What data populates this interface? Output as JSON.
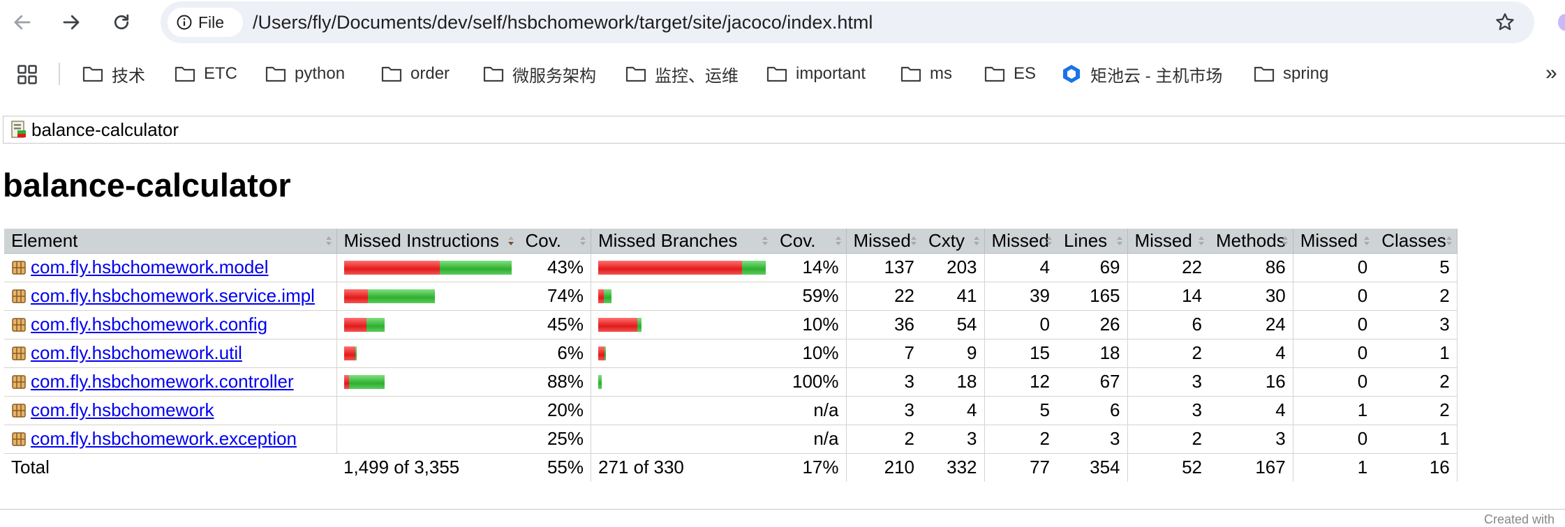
{
  "browser": {
    "chip_label": "File",
    "url": "/Users/fly/Documents/dev/self/hsbchomework/target/site/jacoco/index.html",
    "bookmarks": [
      {
        "label": "技术",
        "icon": "folder-icon"
      },
      {
        "label": "ETC",
        "icon": "folder-icon"
      },
      {
        "label": "python",
        "icon": "folder-icon"
      },
      {
        "label": "order",
        "icon": "folder-icon"
      },
      {
        "label": "微服务架构",
        "icon": "folder-icon"
      },
      {
        "label": "监控、运维",
        "icon": "folder-icon"
      },
      {
        "label": "important",
        "icon": "folder-icon"
      },
      {
        "label": "ms",
        "icon": "folder-icon"
      },
      {
        "label": "ES",
        "icon": "folder-icon"
      },
      {
        "label": "矩池云 - 主机市场",
        "icon": "hexagon-logo-icon"
      },
      {
        "label": "spring",
        "icon": "folder-icon"
      }
    ],
    "more_label": "»"
  },
  "page": {
    "breadcrumb": "balance-calculator",
    "title": "balance-calculator",
    "footer_text": "Created with"
  },
  "colors": {
    "header_bg": "#ced3d6",
    "bar_missed": "#e21a1a",
    "bar_covered": "#2fae2f",
    "link": "#0000ee"
  },
  "table": {
    "headers": [
      "Element",
      "Missed Instructions",
      "Cov.",
      "Missed Branches",
      "Cov.",
      "Missed",
      "Cxty",
      "Missed",
      "Lines",
      "Missed",
      "Methods",
      "Missed",
      "Classes"
    ],
    "rows": [
      {
        "element": "com.fly.hsbchomework.model",
        "instr_cov": "43%",
        "instr_bar": [
          0.57,
          0.43,
          1.0
        ],
        "branch_cov": "14%",
        "branch_bar": [
          0.86,
          0.14,
          1.0
        ],
        "missed_cxty": "137",
        "cxty": "203",
        "missed_lines": "4",
        "lines": "69",
        "missed_methods": "22",
        "methods": "86",
        "missed_classes": "0",
        "classes": "5"
      },
      {
        "element": "com.fly.hsbchomework.service.impl",
        "instr_cov": "74%",
        "instr_bar": [
          0.26,
          0.74,
          0.54
        ],
        "branch_cov": "59%",
        "branch_bar": [
          0.41,
          0.59,
          0.08
        ],
        "missed_cxty": "22",
        "cxty": "41",
        "missed_lines": "39",
        "lines": "165",
        "missed_methods": "14",
        "methods": "30",
        "missed_classes": "0",
        "classes": "2"
      },
      {
        "element": "com.fly.hsbchomework.config",
        "instr_cov": "45%",
        "instr_bar": [
          0.55,
          0.45,
          0.24
        ],
        "branch_cov": "10%",
        "branch_bar": [
          0.9,
          0.1,
          0.26
        ],
        "missed_cxty": "36",
        "cxty": "54",
        "missed_lines": "0",
        "lines": "26",
        "missed_methods": "6",
        "methods": "24",
        "missed_classes": "0",
        "classes": "3"
      },
      {
        "element": "com.fly.hsbchomework.util",
        "instr_cov": "6%",
        "instr_bar": [
          0.94,
          0.06,
          0.07
        ],
        "branch_cov": "10%",
        "branch_bar": [
          0.9,
          0.1,
          0.04
        ],
        "missed_cxty": "7",
        "cxty": "9",
        "missed_lines": "15",
        "lines": "18",
        "missed_methods": "2",
        "methods": "4",
        "missed_classes": "0",
        "classes": "1"
      },
      {
        "element": "com.fly.hsbchomework.controller",
        "instr_cov": "88%",
        "instr_bar": [
          0.12,
          0.88,
          0.24
        ],
        "branch_cov": "100%",
        "branch_bar": [
          0.0,
          1.0,
          0.02
        ],
        "missed_cxty": "3",
        "cxty": "18",
        "missed_lines": "12",
        "lines": "67",
        "missed_methods": "3",
        "methods": "16",
        "missed_classes": "0",
        "classes": "2"
      },
      {
        "element": "com.fly.hsbchomework",
        "instr_cov": "20%",
        "instr_bar": [
          0,
          0,
          0
        ],
        "branch_cov": "n/a",
        "branch_bar": [
          0,
          0,
          0
        ],
        "missed_cxty": "3",
        "cxty": "4",
        "missed_lines": "5",
        "lines": "6",
        "missed_methods": "3",
        "methods": "4",
        "missed_classes": "1",
        "classes": "2"
      },
      {
        "element": "com.fly.hsbchomework.exception",
        "instr_cov": "25%",
        "instr_bar": [
          0,
          0,
          0
        ],
        "branch_cov": "n/a",
        "branch_bar": [
          0,
          0,
          0
        ],
        "missed_cxty": "2",
        "cxty": "3",
        "missed_lines": "2",
        "lines": "3",
        "missed_methods": "2",
        "methods": "3",
        "missed_classes": "0",
        "classes": "1"
      }
    ],
    "total": {
      "label": "Total",
      "missed_instructions": "1,499 of 3,355",
      "instr_cov": "55%",
      "missed_branches": "271 of 330",
      "branch_cov": "17%",
      "missed_cxty": "210",
      "cxty": "332",
      "missed_lines": "77",
      "lines": "354",
      "missed_methods": "52",
      "methods": "167",
      "missed_classes": "1",
      "classes": "16"
    }
  }
}
